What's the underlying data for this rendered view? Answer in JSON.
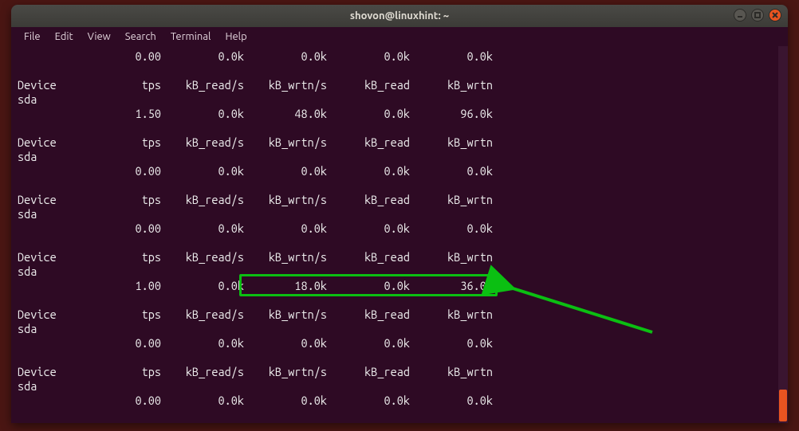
{
  "window": {
    "title": "shovon@linuxhint: ~"
  },
  "menu": {
    "file": "File",
    "edit": "Edit",
    "view": "View",
    "search": "Search",
    "terminal": "Terminal",
    "help": "Help"
  },
  "hdr": {
    "device": "Device",
    "tps": "tps",
    "read_s": "kB_read/s",
    "wrtn_s": "kB_wrtn/s",
    "read": "kB_read",
    "wrtn": "kB_wrtn"
  },
  "dev": "sda",
  "blocks": [
    {
      "tps": "0.00",
      "read_s": "0.0k",
      "wrtn_s": "0.0k",
      "read": "0.0k",
      "wrtn": "0.0k"
    },
    {
      "tps": "1.50",
      "read_s": "0.0k",
      "wrtn_s": "48.0k",
      "read": "0.0k",
      "wrtn": "96.0k"
    },
    {
      "tps": "0.00",
      "read_s": "0.0k",
      "wrtn_s": "0.0k",
      "read": "0.0k",
      "wrtn": "0.0k"
    },
    {
      "tps": "0.00",
      "read_s": "0.0k",
      "wrtn_s": "0.0k",
      "read": "0.0k",
      "wrtn": "0.0k"
    },
    {
      "tps": "1.00",
      "read_s": "0.0k",
      "wrtn_s": "18.0k",
      "read": "0.0k",
      "wrtn": "36.0k"
    },
    {
      "tps": "0.00",
      "read_s": "0.0k",
      "wrtn_s": "0.0k",
      "read": "0.0k",
      "wrtn": "0.0k"
    },
    {
      "tps": "0.00",
      "read_s": "0.0k",
      "wrtn_s": "0.0k",
      "read": "0.0k",
      "wrtn": "0.0k"
    }
  ],
  "first_has_header": false,
  "highlight_block_index": 4
}
